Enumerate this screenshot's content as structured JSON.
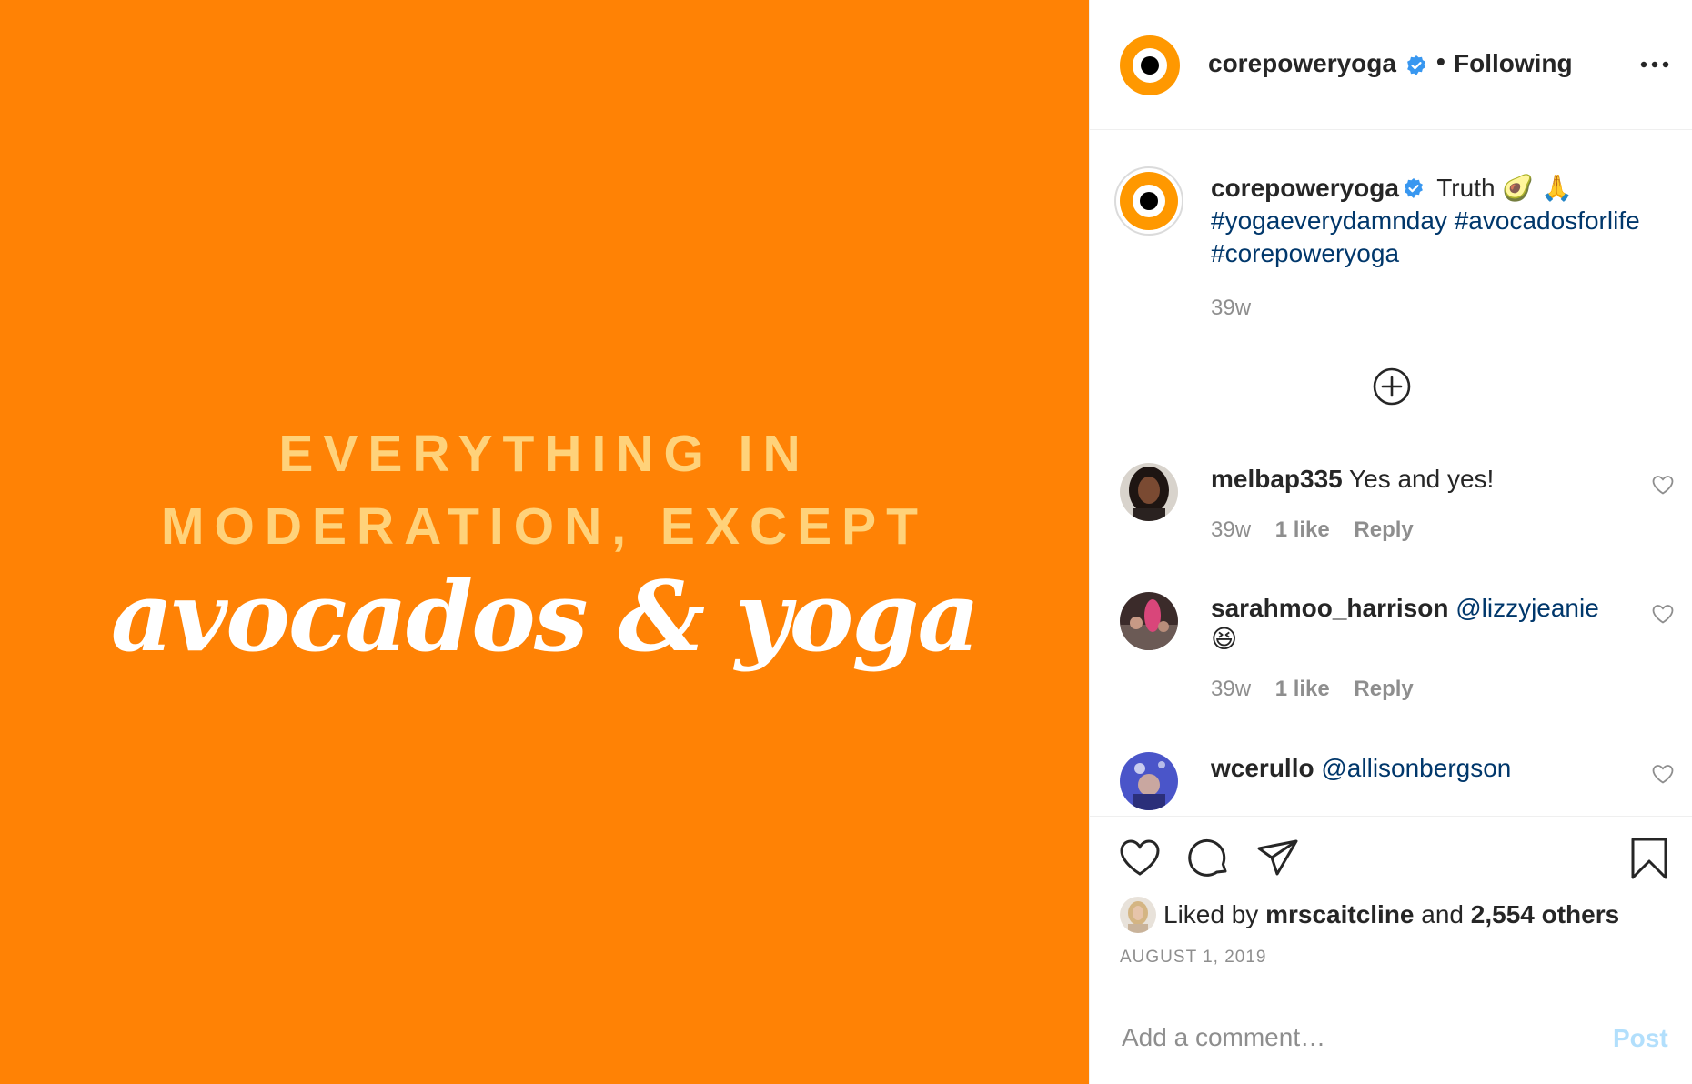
{
  "post_image": {
    "line1": "EVERYTHING IN",
    "line2": "MODERATION, EXCEPT",
    "script_text": "avocados & yoga",
    "background_color": "#ff8205"
  },
  "header": {
    "username": "corepoweryoga",
    "separator": "•",
    "follow_status": "Following",
    "more_icon": "ellipsis-icon"
  },
  "caption": {
    "username": "corepoweryoga",
    "text": " Truth 🥑 🙏",
    "hashtags": [
      "#yogaeverydamnday",
      "#avocadosforlife",
      "#corepoweryoga"
    ],
    "time": "39w"
  },
  "comments": [
    {
      "username": "melbap335",
      "text": "Yes and yes!",
      "mention": "",
      "time": "39w",
      "likes": "1 like",
      "reply": "Reply"
    },
    {
      "username": "sarahmoo_harrison",
      "text": "😆",
      "mention": "@lizzyjeanie",
      "time": "39w",
      "likes": "1 like",
      "reply": "Reply"
    },
    {
      "username": "wcerullo",
      "text": "",
      "mention": "@allisonbergson"
    }
  ],
  "likes": {
    "prefix": "Liked by ",
    "user": "mrscaitcline",
    "middle": " and ",
    "count": "2,554 others"
  },
  "post_date": "AUGUST 1, 2019",
  "add_comment": {
    "placeholder": "Add a comment…",
    "post_label": "Post"
  },
  "colors": {
    "brand_orange": "#ff9800",
    "verified_blue": "#3897f0",
    "hashtag_blue": "#00376b",
    "muted": "#8e8e8e",
    "post_disabled": "#b2dffc"
  }
}
